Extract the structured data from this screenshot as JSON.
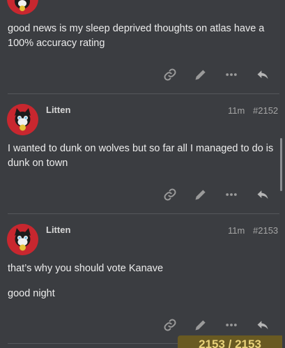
{
  "posts": [
    {
      "body": [
        "good news is my sleep deprived thoughts on atlas have a 100% accuracy rating"
      ]
    },
    {
      "username": "Litten",
      "time": "11m",
      "post_number": "#2152",
      "body": [
        "I wanted to dunk on wolves but so far all I managed to do is dunk on town"
      ]
    },
    {
      "username": "Litten",
      "time": "11m",
      "post_number": "#2153",
      "body": [
        "that’s why you should vote Kanave",
        "good night"
      ]
    }
  ],
  "timeline": {
    "progress_label": "2153 / 2153"
  },
  "icons": [
    "link-icon",
    "pencil-icon",
    "more-icon",
    "reply-icon"
  ],
  "colors": {
    "background": "#3b3d41",
    "avatar": "#c8272f",
    "progress": "#695a22"
  }
}
